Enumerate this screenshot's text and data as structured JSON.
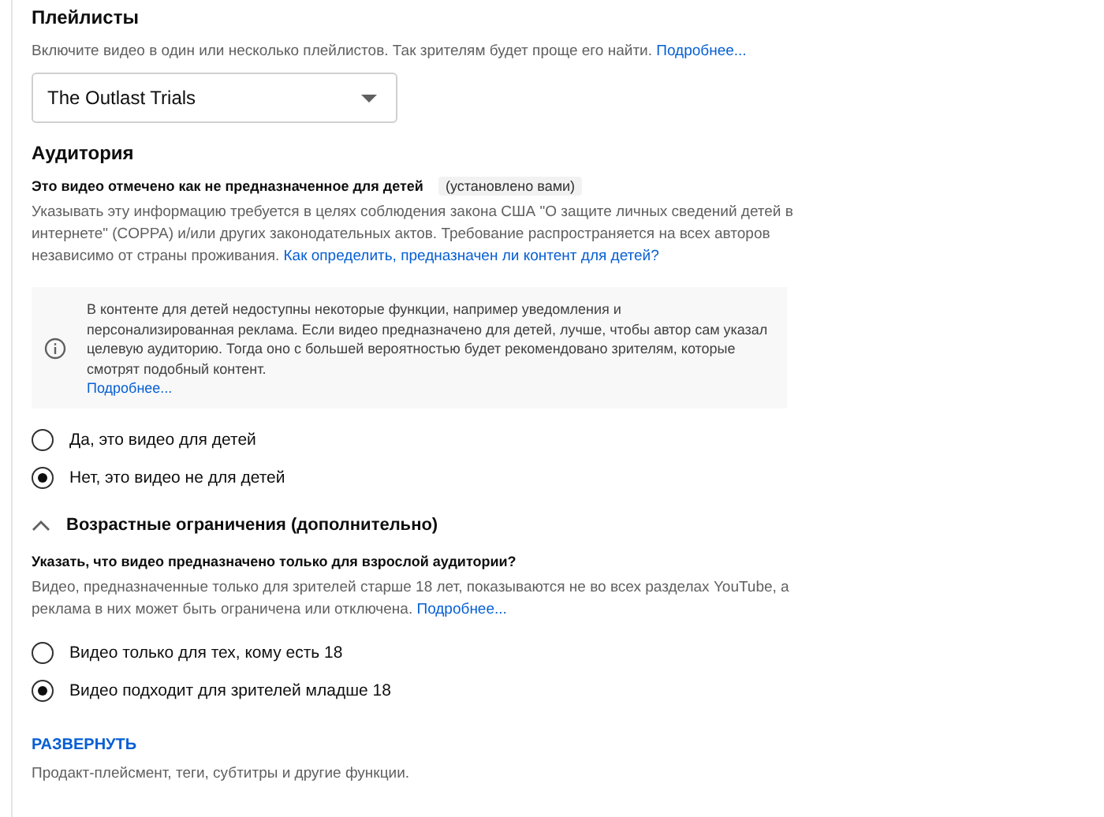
{
  "playlists": {
    "title": "Плейлисты",
    "description": "Включите видео в один или несколько плейлистов. Так зрителям будет проще его найти.",
    "learn_more": "Подробнее...",
    "dropdown": {
      "value": "The Outlast Trials"
    }
  },
  "audience": {
    "title": "Аудитория",
    "status": "Это видео отмечено как не предназначенное для детей",
    "status_tag": "(установлено вами)",
    "description": "Указывать эту информацию требуется в целях соблюдения закона США \"О защите личных сведений детей в интернете\" (COPPA) и/или других законодательных актов. Требование распространяется на всех авторов независимо от страны проживания.",
    "link": "Как определить, предназначен ли контент для детей?",
    "info": {
      "text": "В контенте для детей недоступны некоторые функции, например уведомления и персонализированная реклама. Если видео предназначено для детей, лучше, чтобы автор сам указал целевую аудиторию. Тогда оно с большей вероятностью будет рекомендовано зрителям, которые смотрят подобный контент.",
      "learn_more": "Подробнее..."
    },
    "options": [
      {
        "label": "Да, это видео для детей",
        "selected": false
      },
      {
        "label": "Нет, это видео не для детей",
        "selected": true
      }
    ]
  },
  "age_restriction": {
    "title": "Возрастные ограничения (дополнительно)",
    "expanded": true,
    "question": "Указать, что видео предназначено только для взрослой аудитории?",
    "description": "Видео, предназначенные только для зрителей старше 18 лет, показываются не во всех разделах YouTube, а реклама в них может быть ограничена или отключена.",
    "learn_more": "Подробнее...",
    "options": [
      {
        "label": "Видео только для тех, кому есть 18",
        "selected": false
      },
      {
        "label": "Видео подходит для зрителей младше 18",
        "selected": true
      }
    ]
  },
  "expand": {
    "label": "РАЗВЕРНУТЬ",
    "description": "Продакт-плейсмент, теги, субтитры и другие функции."
  }
}
